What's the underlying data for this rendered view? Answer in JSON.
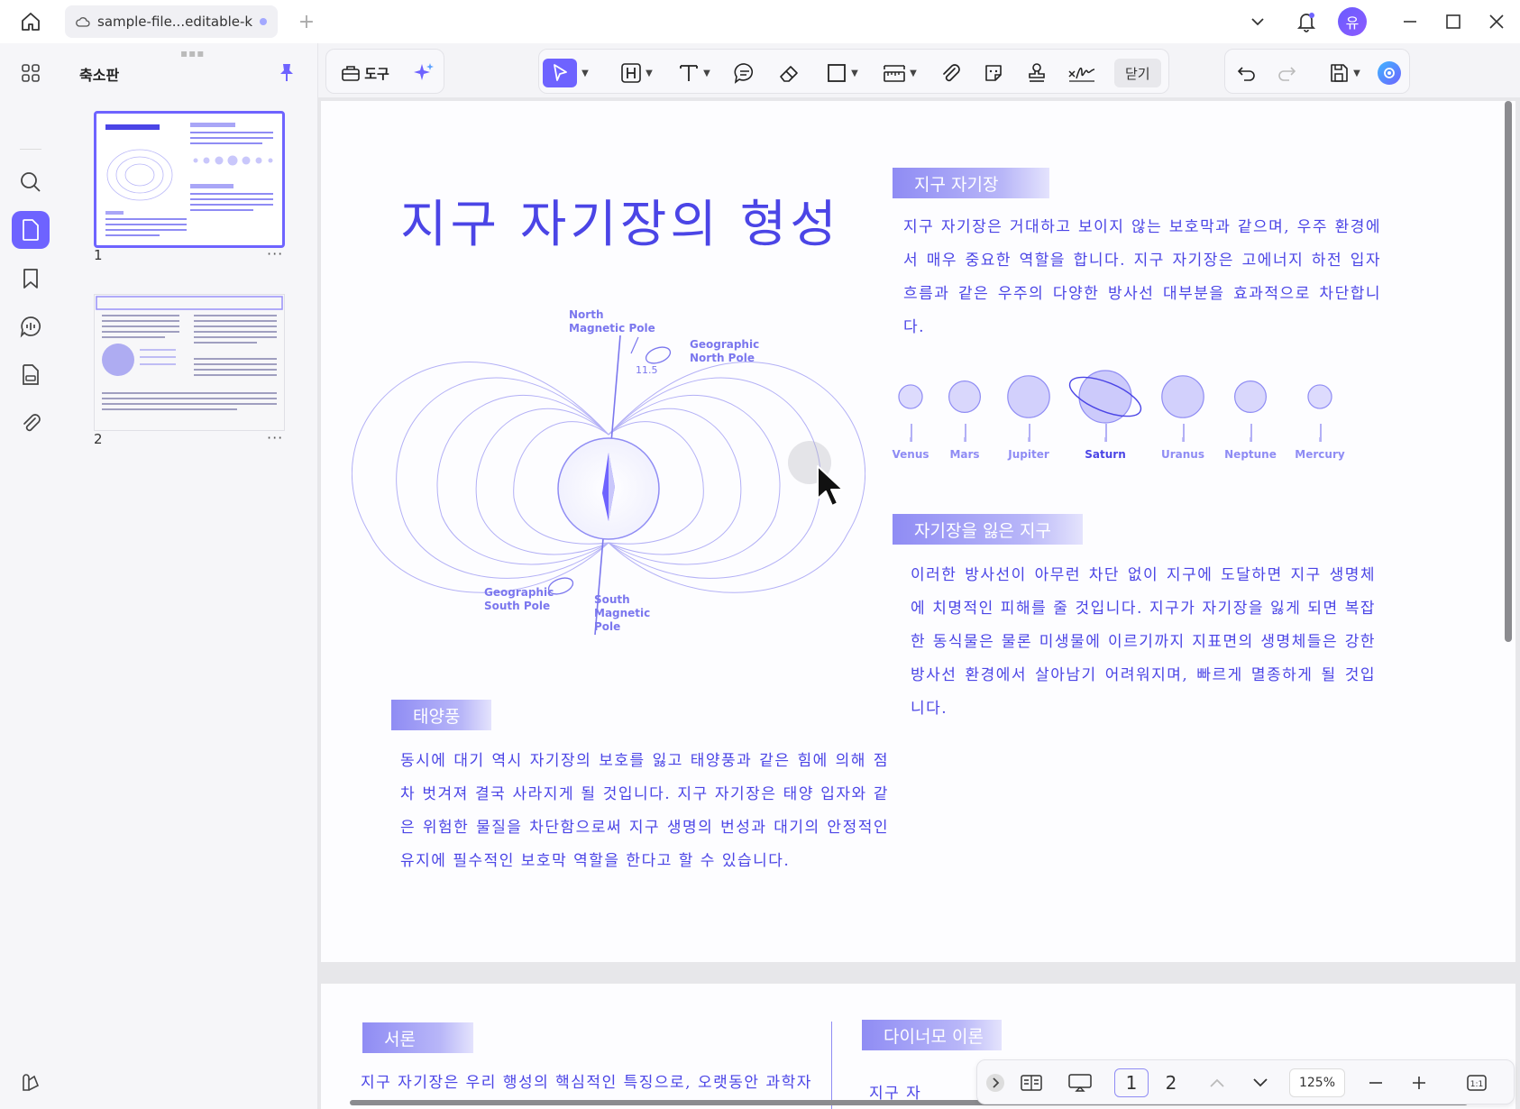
{
  "window": {
    "tab_title": "sample-file...editable-kr",
    "avatar_initial": "유"
  },
  "sidebar": {
    "panel_title": "축소판",
    "pages": [
      {
        "number": "1",
        "more": "···"
      },
      {
        "number": "2",
        "more": "···"
      }
    ]
  },
  "toolbar": {
    "tools_label": "도구",
    "close_label": "닫기"
  },
  "document": {
    "title": "지구 자기장의 형성",
    "sections": {
      "earth_field": {
        "heading": "지구 자기장",
        "body": "지구 자기장은 거대하고 보이지 않는 보호막과 같으며, 우주 환경에서 매우 중요한 역할을 합니다. 지구 자기장은 고에너지 하전 입자흐름과 같은 우주의 다양한 방사선 대부분을 효과적으로 차단합니다."
      },
      "lost_field": {
        "heading": "자기장을 잃은 지구",
        "body": "이러한 방사선이 아무런 차단 없이 지구에 도달하면 지구 생명체에 치명적인 피해를 줄 것입니다. 지구가 자기장을 잃게 되면 복잡한 동식물은 물론 미생물에 이르기까지 지표면의 생명체들은 강한 방사선 환경에서 살아남기 어려워지며, 빠르게 멸종하게 될 것입니다."
      },
      "solar_wind": {
        "heading": "태양풍",
        "body": "동시에 대기 역시 자기장의 보호를 잃고 태양풍과 같은 힘에 의해 점차 벗겨져 결국 사라지게 될 것입니다. 지구 자기장은 태양 입자와 같은 위험한 물질을 차단함으로써 지구 생명의 번성과 대기의 안정적인 유지에 필수적인 보호막 역할을 한다고 할 수 있습니다."
      }
    },
    "diagram": {
      "north_magnetic": "North Magnetic Pole",
      "geographic_north": "Geographic North Pole",
      "angle": "11.5",
      "geographic_south": "Geographic South Pole",
      "south_magnetic": "South Magnetic Pole"
    },
    "planets": [
      {
        "name": "Venus",
        "size": 0.45,
        "ring": false,
        "emphasis": false
      },
      {
        "name": "Mars",
        "size": 0.6,
        "ring": false,
        "emphasis": false
      },
      {
        "name": "Jupiter",
        "size": 0.8,
        "ring": false,
        "emphasis": false
      },
      {
        "name": "Saturn",
        "size": 1.0,
        "ring": true,
        "emphasis": true
      },
      {
        "name": "Uranus",
        "size": 0.8,
        "ring": false,
        "emphasis": false
      },
      {
        "name": "Neptune",
        "size": 0.6,
        "ring": false,
        "emphasis": false
      },
      {
        "name": "Mercury",
        "size": 0.45,
        "ring": false,
        "emphasis": false
      }
    ],
    "page2": {
      "intro_heading": "서론",
      "intro_text": "지구 자기장은 우리 행성의 핵심적인 특징으로, 오랫동안 과학자",
      "dynamo_heading": "다이너모 이론",
      "dynamo_text": "지구 자"
    }
  },
  "page_nav": {
    "page1": "1",
    "page2": "2",
    "zoom": "125%"
  },
  "colors": {
    "accent": "#6e63ff",
    "doc_text": "#4b45e6",
    "planet_fill": "#c9c7fb"
  }
}
